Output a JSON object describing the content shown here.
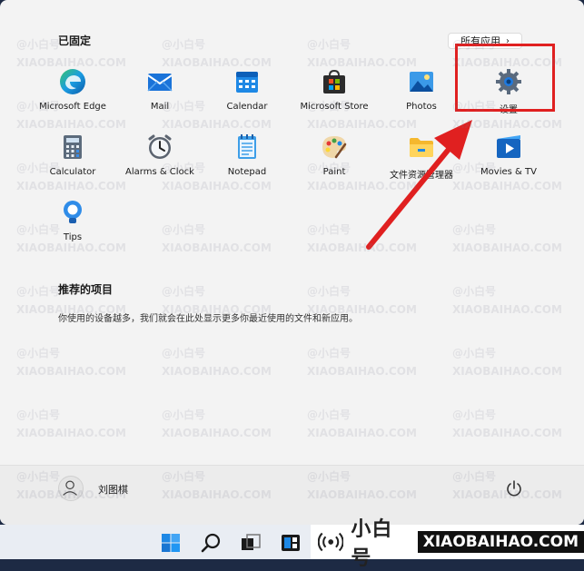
{
  "pinned": {
    "title": "已固定",
    "all_apps_label": "所有应用",
    "apps": [
      {
        "label": "Microsoft Edge",
        "icon": "edge-icon"
      },
      {
        "label": "Mail",
        "icon": "mail-icon"
      },
      {
        "label": "Calendar",
        "icon": "calendar-icon"
      },
      {
        "label": "Microsoft Store",
        "icon": "store-icon"
      },
      {
        "label": "Photos",
        "icon": "photos-icon"
      },
      {
        "label": "设置",
        "icon": "gear-icon"
      },
      {
        "label": "Calculator",
        "icon": "calculator-icon"
      },
      {
        "label": "Alarms & Clock",
        "icon": "clock-icon"
      },
      {
        "label": "Notepad",
        "icon": "notepad-icon"
      },
      {
        "label": "Paint",
        "icon": "paint-icon"
      },
      {
        "label": "文件资源管理器",
        "icon": "folder-icon"
      },
      {
        "label": "Movies & TV",
        "icon": "movies-icon"
      },
      {
        "label": "Tips",
        "icon": "tips-icon"
      }
    ]
  },
  "recommended": {
    "title": "推荐的项目",
    "description": "你使用的设备越多，我们就会在此处显示更多你最近使用的文件和新应用。"
  },
  "footer": {
    "user_name": "刘图棋"
  },
  "brand": {
    "name": "小白号",
    "domain": "XIAOBAIHAO.COM"
  },
  "watermark": {
    "cn": "@小白号",
    "en": "XIAOBAIHAO.COM"
  },
  "colors": {
    "annotation_red": "#e02020",
    "accent_blue": "#0067c0"
  }
}
